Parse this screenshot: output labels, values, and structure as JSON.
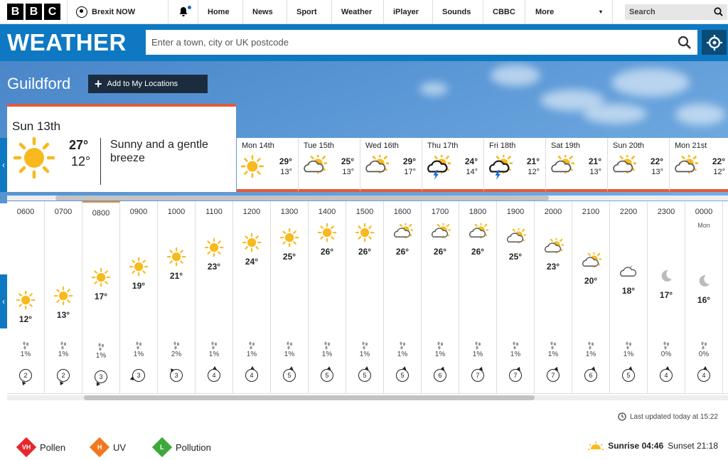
{
  "nav": {
    "logo": [
      "B",
      "B",
      "C"
    ],
    "brexit": "Brexit NOW",
    "links": [
      "Home",
      "News",
      "Sport",
      "Weather",
      "iPlayer",
      "Sounds",
      "CBBC"
    ],
    "more": "More",
    "search": "Search"
  },
  "weather": {
    "title": "WEATHER",
    "placeholder": "Enter a town, city or UK postcode"
  },
  "location": {
    "city": "Guildford",
    "add_label": "Add to My Locations"
  },
  "today": {
    "date": "Sun 13th",
    "high": "27°",
    "low": "12°",
    "description": "Sunny and a gentle breeze"
  },
  "days": [
    {
      "label": "Mon 14th",
      "high": "29°",
      "low": "13°",
      "icon": "sun-icon"
    },
    {
      "label": "Tue 15th",
      "high": "25°",
      "low": "13°",
      "icon": "sun-cloud-icon"
    },
    {
      "label": "Wed 16th",
      "high": "29°",
      "low": "17°",
      "icon": "sun-cloud-icon"
    },
    {
      "label": "Thu 17th",
      "high": "24°",
      "low": "14°",
      "icon": "thunder-icon"
    },
    {
      "label": "Fri 18th",
      "high": "21°",
      "low": "12°",
      "icon": "thunder-icon"
    },
    {
      "label": "Sat 19th",
      "high": "21°",
      "low": "13°",
      "icon": "sun-cloud-icon"
    },
    {
      "label": "Sun 20th",
      "high": "22°",
      "low": "13°",
      "icon": "sun-cloud-icon"
    },
    {
      "label": "Mon 21st",
      "high": "22°",
      "low": "12°",
      "icon": "sun-cloud-icon"
    }
  ],
  "hours": [
    {
      "time": "0600",
      "temp": "12°",
      "rain": "1%",
      "wind": "2",
      "icon": "sun-icon"
    },
    {
      "time": "0700",
      "temp": "13°",
      "rain": "1%",
      "wind": "2",
      "icon": "sun-icon"
    },
    {
      "time": "0800",
      "temp": "17°",
      "rain": "1%",
      "wind": "3",
      "icon": "sun-icon"
    },
    {
      "time": "0900",
      "temp": "19°",
      "rain": "1%",
      "wind": "3",
      "icon": "sun-icon"
    },
    {
      "time": "1000",
      "temp": "21°",
      "rain": "2%",
      "wind": "3",
      "icon": "sun-icon"
    },
    {
      "time": "1100",
      "temp": "23°",
      "rain": "1%",
      "wind": "4",
      "icon": "sun-icon"
    },
    {
      "time": "1200",
      "temp": "24°",
      "rain": "1%",
      "wind": "4",
      "icon": "sun-icon"
    },
    {
      "time": "1300",
      "temp": "25°",
      "rain": "1%",
      "wind": "5",
      "icon": "sun-icon"
    },
    {
      "time": "1400",
      "temp": "26°",
      "rain": "1%",
      "wind": "5",
      "icon": "sun-icon"
    },
    {
      "time": "1500",
      "temp": "26°",
      "rain": "1%",
      "wind": "5",
      "icon": "sun-icon"
    },
    {
      "time": "1600",
      "temp": "26°",
      "rain": "1%",
      "wind": "5",
      "icon": "sun-cloud-icon"
    },
    {
      "time": "1700",
      "temp": "26°",
      "rain": "1%",
      "wind": "6",
      "icon": "sun-cloud-icon"
    },
    {
      "time": "1800",
      "temp": "26°",
      "rain": "1%",
      "wind": "7",
      "icon": "sun-cloud-icon"
    },
    {
      "time": "1900",
      "temp": "25°",
      "rain": "1%",
      "wind": "7",
      "icon": "sun-cloud-icon"
    },
    {
      "time": "2000",
      "temp": "23°",
      "rain": "1%",
      "wind": "7",
      "icon": "sun-cloud-icon"
    },
    {
      "time": "2100",
      "temp": "20°",
      "rain": "1%",
      "wind": "6",
      "icon": "sun-cloud-icon"
    },
    {
      "time": "2200",
      "temp": "18°",
      "rain": "1%",
      "wind": "5",
      "icon": "moon-cloud-icon"
    },
    {
      "time": "2300",
      "temp": "17°",
      "rain": "0%",
      "wind": "4",
      "icon": "moon-icon"
    },
    {
      "time": "0000",
      "day": "Mon",
      "temp": "16°",
      "rain": "0%",
      "wind": "4",
      "icon": "moon-icon"
    }
  ],
  "footer": {
    "updated": "Last updated today at 15:22",
    "pollen": {
      "code": "VH",
      "label": "Pollen",
      "color": "#e8262b"
    },
    "uv": {
      "code": "H",
      "label": "UV",
      "color": "#f07820"
    },
    "pollution": {
      "code": "L",
      "label": "Pollution",
      "color": "#3ea83b"
    },
    "sunrise": "Sunrise 04:46",
    "sunset": "Sunset 21:18"
  },
  "colors": {
    "accent": "#0e79c2",
    "bar": "#e35b3b",
    "sun": "#f7b91d"
  }
}
